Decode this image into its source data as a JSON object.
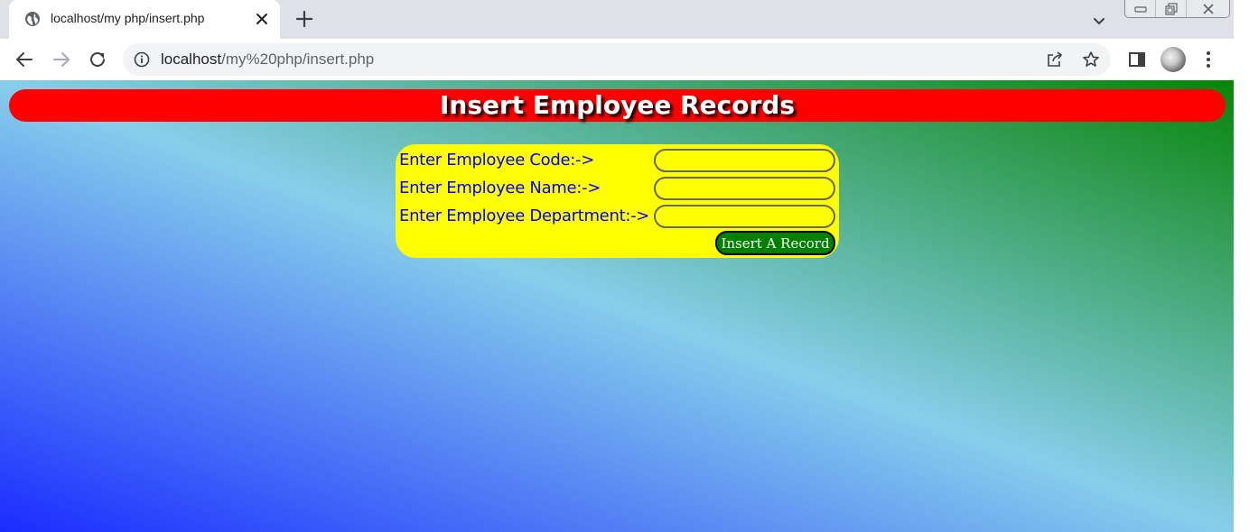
{
  "browser": {
    "tab_title": "localhost/my php/insert.php",
    "url_host": "localhost",
    "url_path": "/my%20php/insert.php"
  },
  "page": {
    "heading": "Insert Employee Records",
    "form": {
      "fields": [
        {
          "label": "Enter Employee Code:->",
          "value": ""
        },
        {
          "label": "Enter Employee Name:->",
          "value": ""
        },
        {
          "label": "Enter Employee Department:->",
          "value": ""
        }
      ],
      "submit_label": "Insert A Record"
    }
  },
  "colors": {
    "heading_bg": "#ff0000",
    "heading_text": "#ffffff",
    "form_bg": "#ffff00",
    "label_text": "#0000ff",
    "button_bg": "#008000",
    "gradient": [
      "#1a2cff",
      "#87ceeb",
      "#078407"
    ]
  },
  "icons": {
    "tab": [
      "globe-icon",
      "close-icon",
      "plus-icon",
      "chevron-down-icon"
    ],
    "window": [
      "minimize-icon",
      "restore-icon",
      "close-icon"
    ],
    "toolbar": [
      "back-arrow-icon",
      "forward-arrow-icon",
      "reload-icon",
      "info-icon",
      "share-icon",
      "star-icon",
      "side-panel-icon",
      "avatar",
      "kebab-menu-icon"
    ]
  }
}
